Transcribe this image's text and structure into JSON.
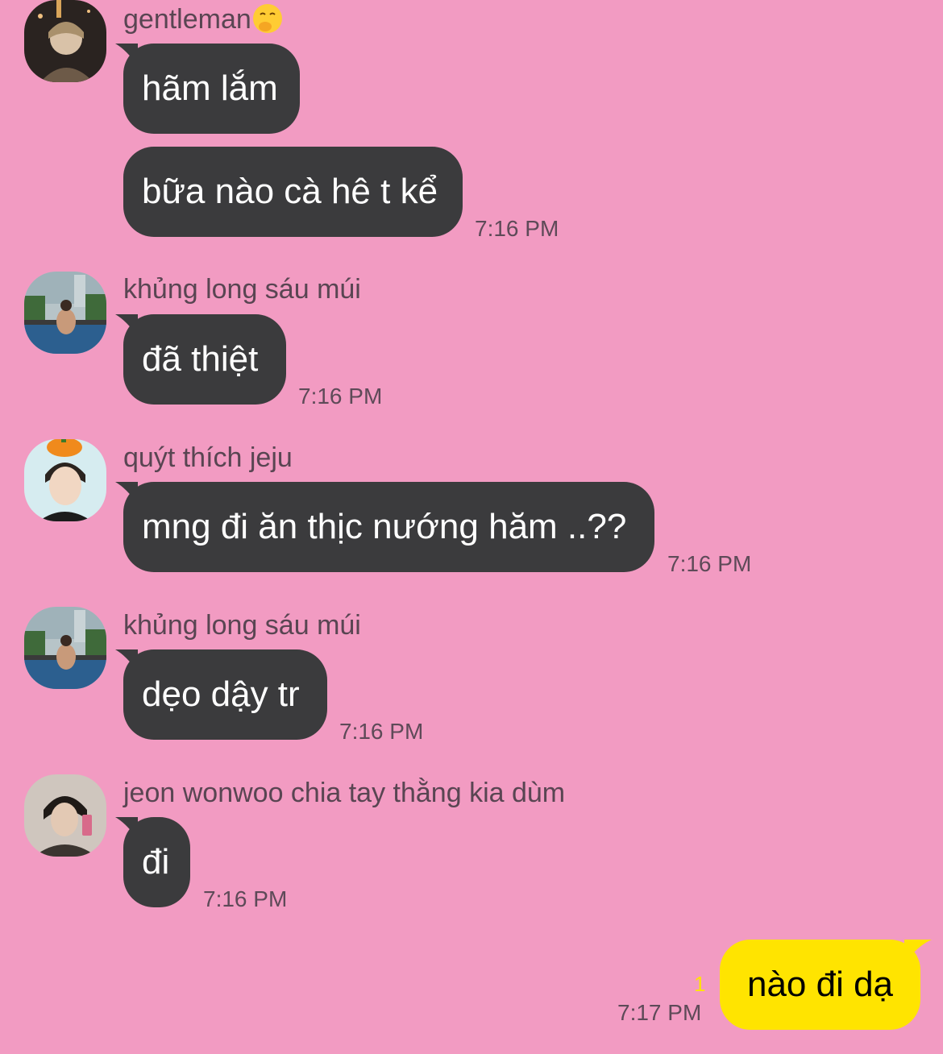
{
  "colors": {
    "background": "#f29bc2",
    "incoming_bubble": "#3b3b3d",
    "outgoing_bubble": "#ffe400",
    "sender_text": "#594552",
    "unread_count": "#ffe400"
  },
  "messages": [
    {
      "sender": "gentleman",
      "sender_emoji": "hand-over-mouth-emoji",
      "avatar_icon": "avatar-gentleman",
      "bubbles": [
        {
          "text": "hãm lắm"
        },
        {
          "text": "bữa nào cà hê t kể",
          "time": "7:16 PM"
        }
      ]
    },
    {
      "sender": "khủng long sáu múi",
      "avatar_icon": "avatar-pool",
      "bubbles": [
        {
          "text": "đã thiệt",
          "time": "7:16 PM"
        }
      ]
    },
    {
      "sender": "quýt thích jeju",
      "avatar_icon": "avatar-tangerine",
      "bubbles": [
        {
          "text": "mng đi ăn thịc nướng hăm ..??",
          "time": "7:16 PM"
        }
      ]
    },
    {
      "sender": "khủng long sáu múi",
      "avatar_icon": "avatar-pool",
      "bubbles": [
        {
          "text": "dẹo dậy tr",
          "time": "7:16 PM"
        }
      ]
    },
    {
      "sender": "jeon wonwoo chia tay thằng kia dùm",
      "avatar_icon": "avatar-wonwoo",
      "bubbles": [
        {
          "text": "đi",
          "time": "7:16 PM"
        }
      ]
    }
  ],
  "my_message": {
    "text": "nào đi dạ",
    "time": "7:17 PM",
    "unread_count": "1"
  }
}
